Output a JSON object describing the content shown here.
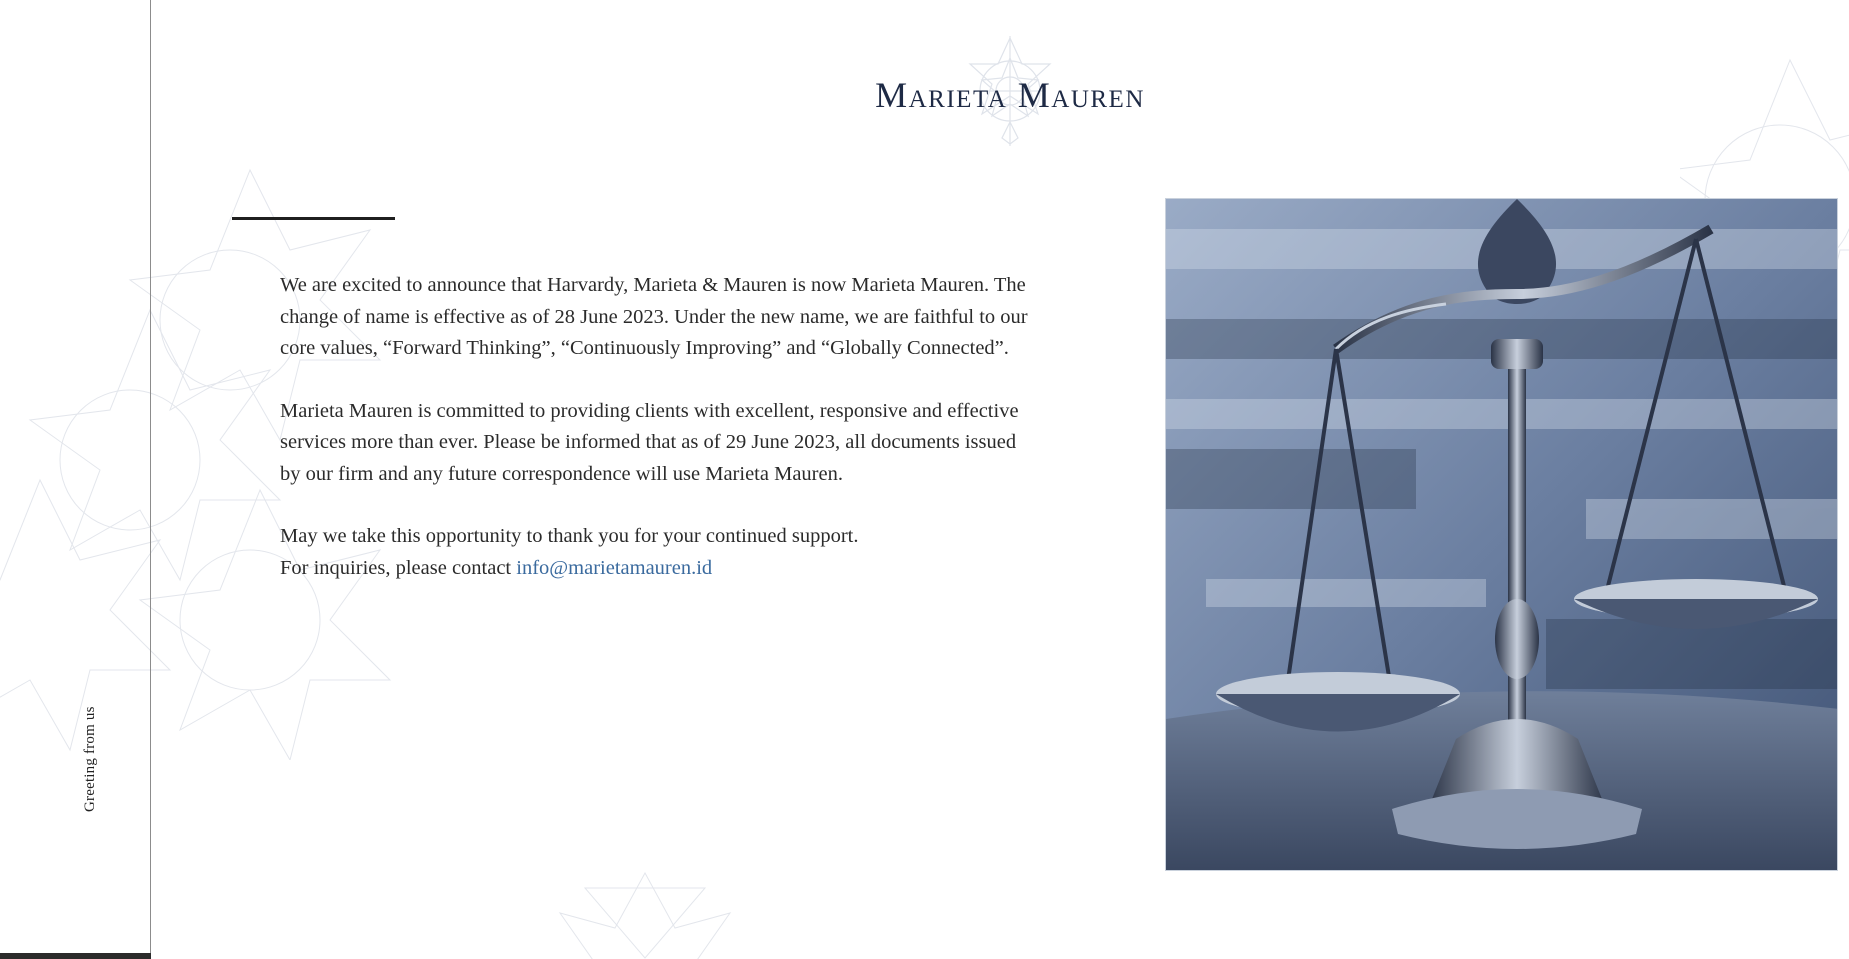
{
  "brand": {
    "name": "Marieta Mauren",
    "primary_color": "#1e2a45",
    "link_color": "#3a6a9e"
  },
  "sidebar": {
    "label": "Greeting from us"
  },
  "announcement": {
    "paragraph1": "We are excited to announce that Harvardy, Marieta & Mauren is now Marieta Mauren. The change of name is effective as of 28 June 2023. Under the new name, we are faithful to our core values, “Forward Thinking”, “Continuously Improving” and “Globally Connected”.",
    "paragraph2": "Marieta Mauren is committed to providing clients with excellent, responsive and effective services more than ever. Please be informed that as of 29 June 2023, all documents issued by our firm and any future correspondence will use Marieta Mauren.",
    "paragraph3": "May we take this opportunity to thank you for your continued support.",
    "inquiry_prefix": "For inquiries, please contact ",
    "email": "info@marietamauren.id"
  },
  "image": {
    "subject": "scales-of-justice-photo"
  }
}
